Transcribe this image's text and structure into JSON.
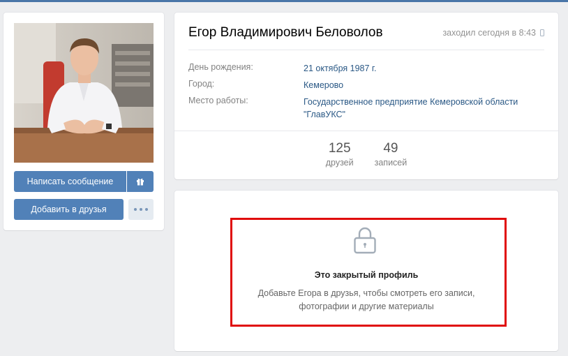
{
  "profile": {
    "name": "Егор Владимирович Беловолов",
    "online": "заходил сегодня в 8:43",
    "info": [
      {
        "label": "День рождения:",
        "value": "21 октября 1987 г."
      },
      {
        "label": "Город:",
        "value": "Кемерово"
      },
      {
        "label": "Место работы:",
        "value": "Государственное предприятие Кемеровской области \"ГлавУКС\""
      }
    ],
    "counters": [
      {
        "num": "125",
        "label": "друзей"
      },
      {
        "num": "49",
        "label": "записей"
      }
    ]
  },
  "actions": {
    "message_label": "Написать сообщение",
    "add_friend_label": "Добавить в друзья"
  },
  "closed": {
    "title": "Это закрытый профиль",
    "line1": "Добавьте Егора в друзья, чтобы смотреть его записи,",
    "line2": "фотографии и другие материалы"
  },
  "icons": {
    "gift": "gift-icon",
    "more": "more-dots-icon",
    "lock": "lock-icon",
    "phone": "mobile-phone-icon"
  },
  "colors": {
    "accent": "#5181b8",
    "link": "#2a5885",
    "frame": "#e00b0b",
    "background": "#edeef0"
  }
}
